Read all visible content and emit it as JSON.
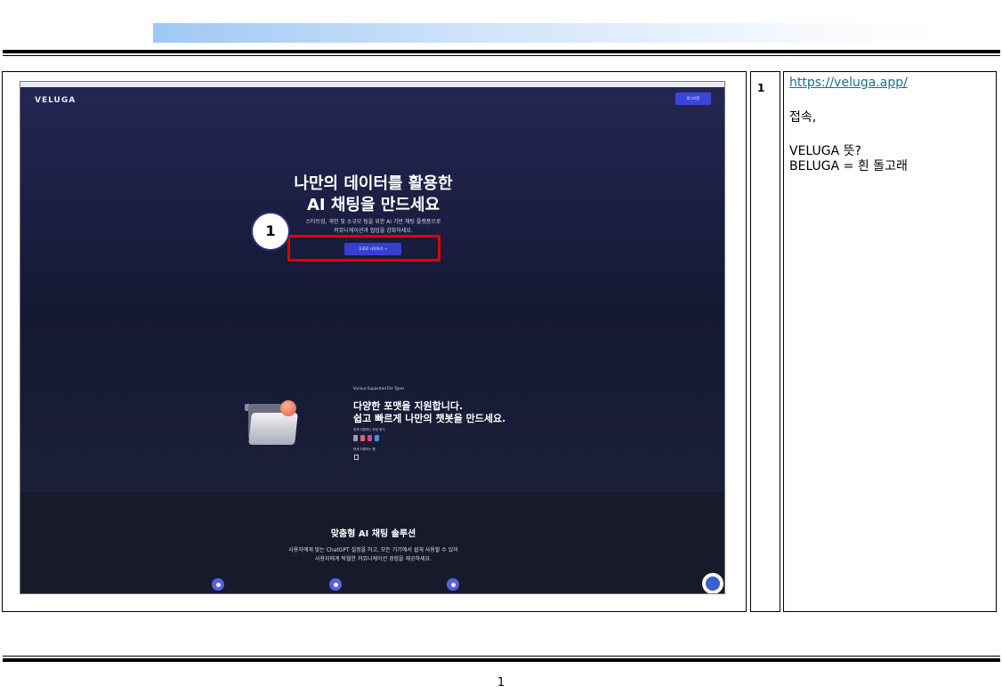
{
  "hero": {
    "logo": "VELUGA",
    "login_button": "로그이웃",
    "title_line1": "나만의 데이터를 활용한",
    "title_line2": "AI 채팅을 만드세요",
    "subtitle_line1": "스타트업, 개인 및 소규모 팀을 위한 AI 기반 채팅 플랫폼으로",
    "subtitle_line2": "커뮤니케이션과 협업을 강화하세요.",
    "cta_button": "무료로 시작하기 →"
  },
  "annotation": {
    "marker": "1"
  },
  "formats": {
    "tag": "Various Supported File Types",
    "heading_line1": "다양한 포맷을 지원합니다.",
    "heading_line2": "쉽고 빠르게 나만의 챗봇을 만드세요.",
    "file_label": "현재 지원하는 파일 형식",
    "web_label": "현재 지원하는 웹",
    "file_colors": [
      "#9aa0b8",
      "#e85c7a",
      "#d63b9a",
      "#3f8fe8"
    ]
  },
  "solution": {
    "heading": "맞춤형 AI 채팅 솔루션",
    "desc_line1": "사용자에게 맞는 ChatGPT 설정을 하고, 모든 기기에서 쉽게 사용할 수 있어",
    "desc_line2": "사용자에게 탁월한 커뮤니케이션 경험을 제공하세요."
  },
  "notes": {
    "row_number": "1",
    "url": "https://veluga.app/",
    "line_connect": "접속,",
    "line_meaning": "VELUGA 뜻?",
    "line_beluga": "BELUGA = 흰 돌고래"
  },
  "footer": {
    "page_number": "1"
  }
}
